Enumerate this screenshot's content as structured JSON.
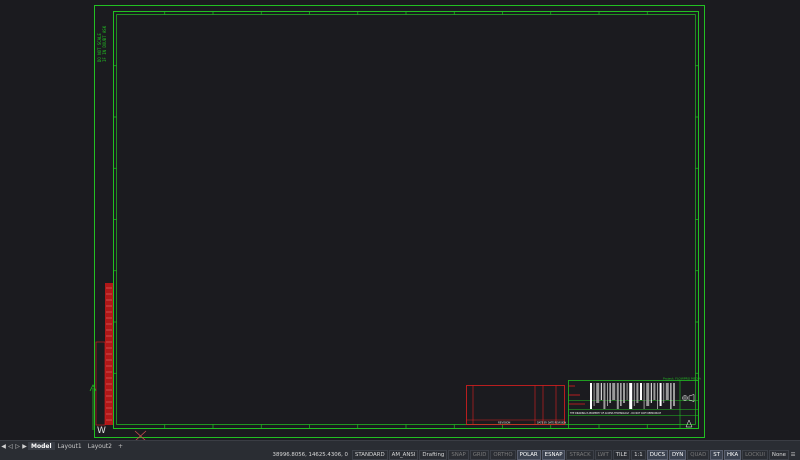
{
  "drawing": {
    "border_color": "#22c022",
    "red_color": "#e02020",
    "side_note": "DO NOT SCALE",
    "side_note2": "IF IN DOUBT ASK",
    "frame_letter": "W",
    "project_label": "Project: FLOWPRO MEDIA",
    "title_note": "THE DRAWING IS PROPERTY OF ACCESS TECHNOLOGY - DO NOT COPY REPRODUCE",
    "rev_label": "REVISION",
    "rev_note": "DATE BY DATE REVISION"
  },
  "tabs": {
    "items": [
      {
        "label": "Model",
        "active": true
      },
      {
        "label": "Layout1",
        "active": false
      },
      {
        "label": "Layout2",
        "active": false
      }
    ],
    "add_label": "+"
  },
  "status": {
    "coordinates": "38996.8056, 14625.4306, 0",
    "menu_icon": "hamburger-icon",
    "buttons": [
      {
        "label": "STANDARD",
        "state": "plain"
      },
      {
        "label": "AM_ANSI",
        "state": "plain"
      },
      {
        "label": "Drafting",
        "state": "plain"
      },
      {
        "label": "SNAP",
        "state": "off"
      },
      {
        "label": "GRID",
        "state": "off"
      },
      {
        "label": "ORTHO",
        "state": "off"
      },
      {
        "label": "POLAR",
        "state": "on"
      },
      {
        "label": "ESNAP",
        "state": "on"
      },
      {
        "label": "STRACK",
        "state": "off"
      },
      {
        "label": "LWT",
        "state": "off"
      },
      {
        "label": "TILE",
        "state": "plain"
      },
      {
        "label": "1:1",
        "state": "plain"
      },
      {
        "label": "DUCS",
        "state": "on"
      },
      {
        "label": "DYN",
        "state": "on"
      },
      {
        "label": "QUAD",
        "state": "off"
      },
      {
        "label": "ST",
        "state": "on"
      },
      {
        "label": "HKA",
        "state": "on"
      },
      {
        "label": "LOCKUI",
        "state": "off"
      },
      {
        "label": "None",
        "state": "plain"
      }
    ]
  }
}
